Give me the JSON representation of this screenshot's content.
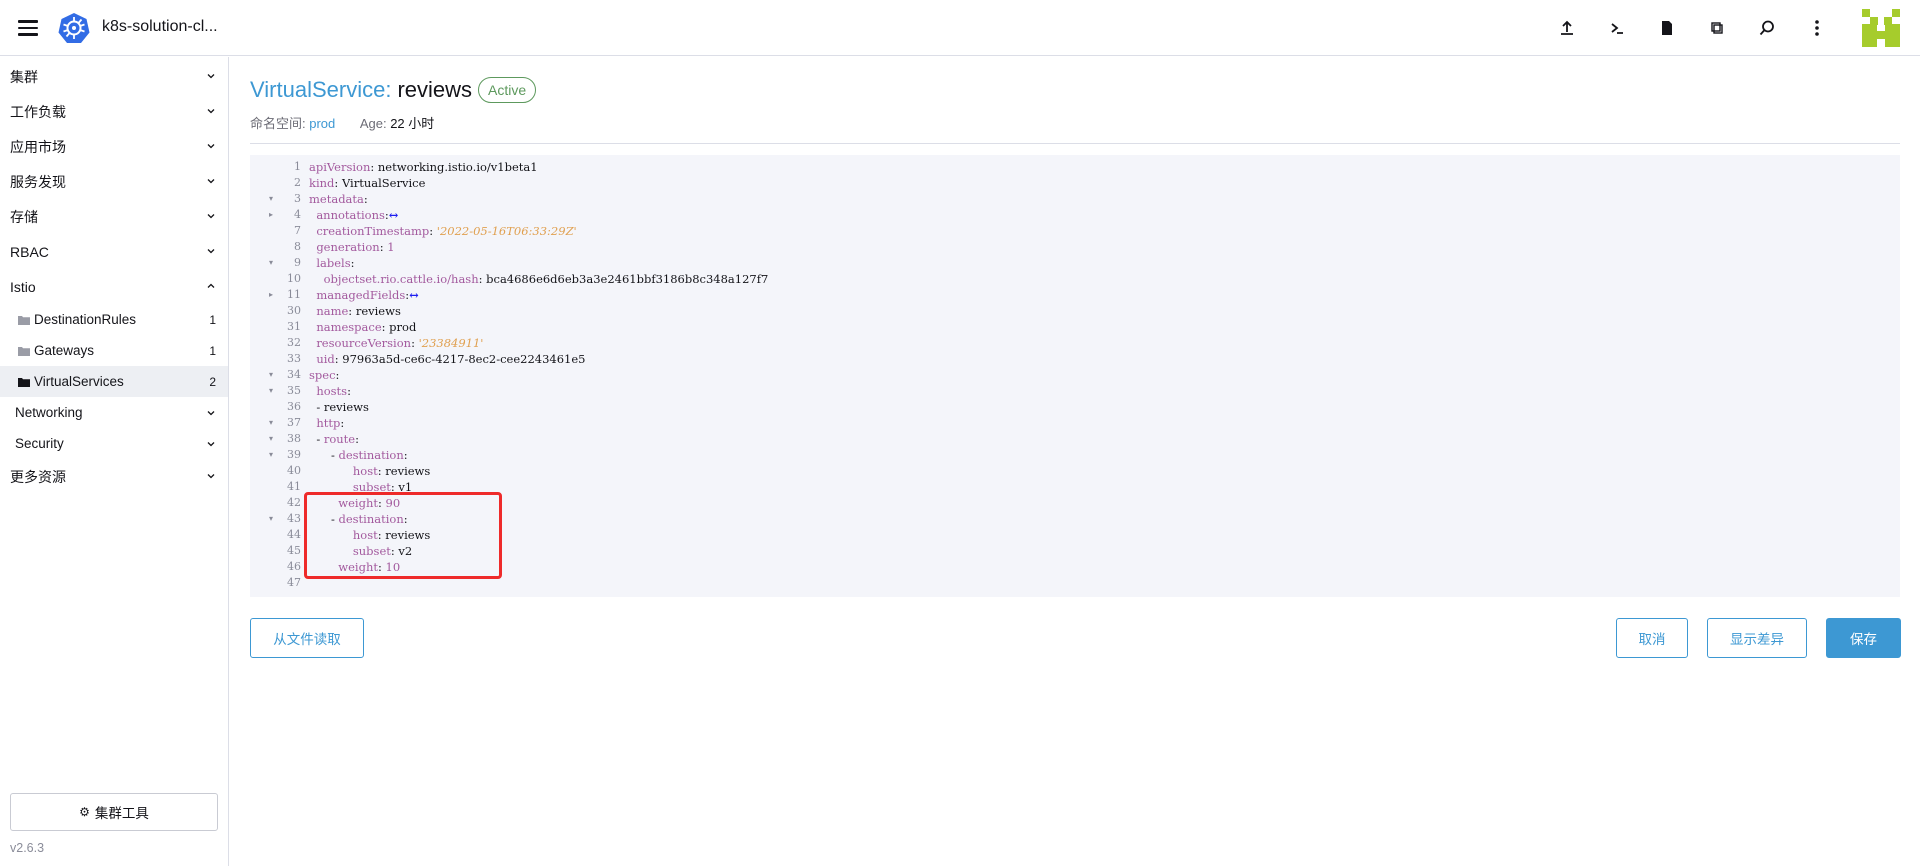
{
  "header": {
    "cluster_name": "k8s-solution-cl...",
    "icons": [
      "upload-icon",
      "shell-icon",
      "file-icon",
      "copy-icon",
      "search-icon",
      "more-vert-icon"
    ]
  },
  "sidebar": {
    "groups": [
      {
        "label": "集群"
      },
      {
        "label": "工作负载"
      },
      {
        "label": "应用市场"
      },
      {
        "label": "服务发现"
      },
      {
        "label": "存储"
      },
      {
        "label": "RBAC"
      },
      {
        "label": "Istio"
      }
    ],
    "istio_children": [
      {
        "label": "DestinationRules",
        "count": "1"
      },
      {
        "label": "Gateways",
        "count": "1"
      },
      {
        "label": "VirtualServices",
        "count": "2"
      }
    ],
    "sub_groups": [
      {
        "label": "Networking"
      },
      {
        "label": "Security"
      }
    ],
    "more_resources": "更多资源",
    "tools_label": "集群工具",
    "version": "v2.6.3"
  },
  "page": {
    "type_label": "VirtualService:",
    "name": "reviews",
    "state": "Active",
    "namespace_label": "命名空间:",
    "namespace": "prod",
    "age_label": "Age:",
    "age": "22 小时"
  },
  "yaml": [
    {
      "ln": "1",
      "fold": "",
      "indent": "",
      "parts": [
        [
          "k",
          "apiVersion"
        ],
        [
          "v",
          ": networking.istio.io/v1beta1"
        ]
      ]
    },
    {
      "ln": "2",
      "fold": "",
      "indent": "",
      "parts": [
        [
          "k",
          "kind"
        ],
        [
          "v",
          ": VirtualService"
        ]
      ]
    },
    {
      "ln": "3",
      "fold": "▾",
      "indent": "",
      "parts": [
        [
          "k",
          "metadata"
        ],
        [
          "v",
          ":"
        ]
      ]
    },
    {
      "ln": "4",
      "fold": "▸",
      "indent": "  ",
      "parts": [
        [
          "k",
          "annotations"
        ],
        [
          "v",
          ":"
        ],
        [
          "c",
          "↔"
        ]
      ]
    },
    {
      "ln": "7",
      "fold": "",
      "indent": "  ",
      "parts": [
        [
          "k",
          "creationTimestamp"
        ],
        [
          "v",
          ": "
        ],
        [
          "s",
          "'2022-05-16T06:33:29Z'"
        ]
      ]
    },
    {
      "ln": "8",
      "fold": "",
      "indent": "  ",
      "parts": [
        [
          "k",
          "generation"
        ],
        [
          "v",
          ": "
        ],
        [
          "n",
          "1"
        ]
      ]
    },
    {
      "ln": "9",
      "fold": "▾",
      "indent": "  ",
      "parts": [
        [
          "k",
          "labels"
        ],
        [
          "v",
          ":"
        ]
      ]
    },
    {
      "ln": "10",
      "fold": "",
      "indent": "    ",
      "parts": [
        [
          "k",
          "objectset.rio.cattle.io/hash"
        ],
        [
          "v",
          ": bca4686e6d6eb3a3e2461bbf3186b8c348a127f7"
        ]
      ]
    },
    {
      "ln": "11",
      "fold": "▸",
      "indent": "  ",
      "parts": [
        [
          "k",
          "managedFields"
        ],
        [
          "v",
          ":"
        ],
        [
          "c",
          "↔"
        ]
      ]
    },
    {
      "ln": "30",
      "fold": "",
      "indent": "  ",
      "parts": [
        [
          "k",
          "name"
        ],
        [
          "v",
          ": reviews"
        ]
      ]
    },
    {
      "ln": "31",
      "fold": "",
      "indent": "  ",
      "parts": [
        [
          "k",
          "namespace"
        ],
        [
          "v",
          ": prod"
        ]
      ]
    },
    {
      "ln": "32",
      "fold": "",
      "indent": "  ",
      "parts": [
        [
          "k",
          "resourceVersion"
        ],
        [
          "v",
          ": "
        ],
        [
          "s",
          "'23384911'"
        ]
      ]
    },
    {
      "ln": "33",
      "fold": "",
      "indent": "  ",
      "parts": [
        [
          "k",
          "uid"
        ],
        [
          "v",
          ": 97963a5d-ce6c-4217-8ec2-cee2243461e5"
        ]
      ]
    },
    {
      "ln": "34",
      "fold": "▾",
      "indent": "",
      "parts": [
        [
          "k",
          "spec"
        ],
        [
          "v",
          ":"
        ]
      ]
    },
    {
      "ln": "35",
      "fold": "▾",
      "indent": "  ",
      "parts": [
        [
          "k",
          "hosts"
        ],
        [
          "v",
          ":"
        ]
      ]
    },
    {
      "ln": "36",
      "fold": "",
      "indent": "  ",
      "parts": [
        [
          "v",
          "- reviews"
        ]
      ]
    },
    {
      "ln": "37",
      "fold": "▾",
      "indent": "  ",
      "parts": [
        [
          "k",
          "http"
        ],
        [
          "v",
          ":"
        ]
      ]
    },
    {
      "ln": "38",
      "fold": "▾",
      "indent": "  ",
      "parts": [
        [
          "v",
          "- "
        ],
        [
          "k",
          "route"
        ],
        [
          "v",
          ":"
        ]
      ]
    },
    {
      "ln": "39",
      "fold": "▾",
      "indent": "      ",
      "parts": [
        [
          "v",
          "- "
        ],
        [
          "k",
          "destination"
        ],
        [
          "v",
          ":"
        ]
      ]
    },
    {
      "ln": "40",
      "fold": "",
      "indent": "            ",
      "parts": [
        [
          "k",
          "host"
        ],
        [
          "v",
          ": reviews"
        ]
      ]
    },
    {
      "ln": "41",
      "fold": "",
      "indent": "            ",
      "parts": [
        [
          "k",
          "subset"
        ],
        [
          "v",
          ": v1"
        ]
      ]
    },
    {
      "ln": "42",
      "fold": "",
      "indent": "        ",
      "parts": [
        [
          "k",
          "weight"
        ],
        [
          "v",
          ": "
        ],
        [
          "n",
          "90"
        ]
      ]
    },
    {
      "ln": "43",
      "fold": "▾",
      "indent": "      ",
      "parts": [
        [
          "v",
          "- "
        ],
        [
          "k",
          "destination"
        ],
        [
          "v",
          ":"
        ]
      ]
    },
    {
      "ln": "44",
      "fold": "",
      "indent": "            ",
      "parts": [
        [
          "k",
          "host"
        ],
        [
          "v",
          ": reviews"
        ]
      ]
    },
    {
      "ln": "45",
      "fold": "",
      "indent": "            ",
      "parts": [
        [
          "k",
          "subset"
        ],
        [
          "v",
          ": v2"
        ]
      ]
    },
    {
      "ln": "46",
      "fold": "",
      "indent": "        ",
      "parts": [
        [
          "k",
          "weight"
        ],
        [
          "v",
          ": "
        ],
        [
          "n",
          "10"
        ]
      ]
    },
    {
      "ln": "47",
      "fold": "",
      "indent": "",
      "parts": []
    }
  ],
  "footer": {
    "read_file": "从文件读取",
    "cancel": "取消",
    "show_diff": "显示差异",
    "save": "保存"
  },
  "colors": {
    "accent": "#3d98d3",
    "active_state": "#5d995d",
    "highlight_box": "#ee2a2a",
    "logo": "#326ce5",
    "avatar": "#a6cc2c"
  }
}
